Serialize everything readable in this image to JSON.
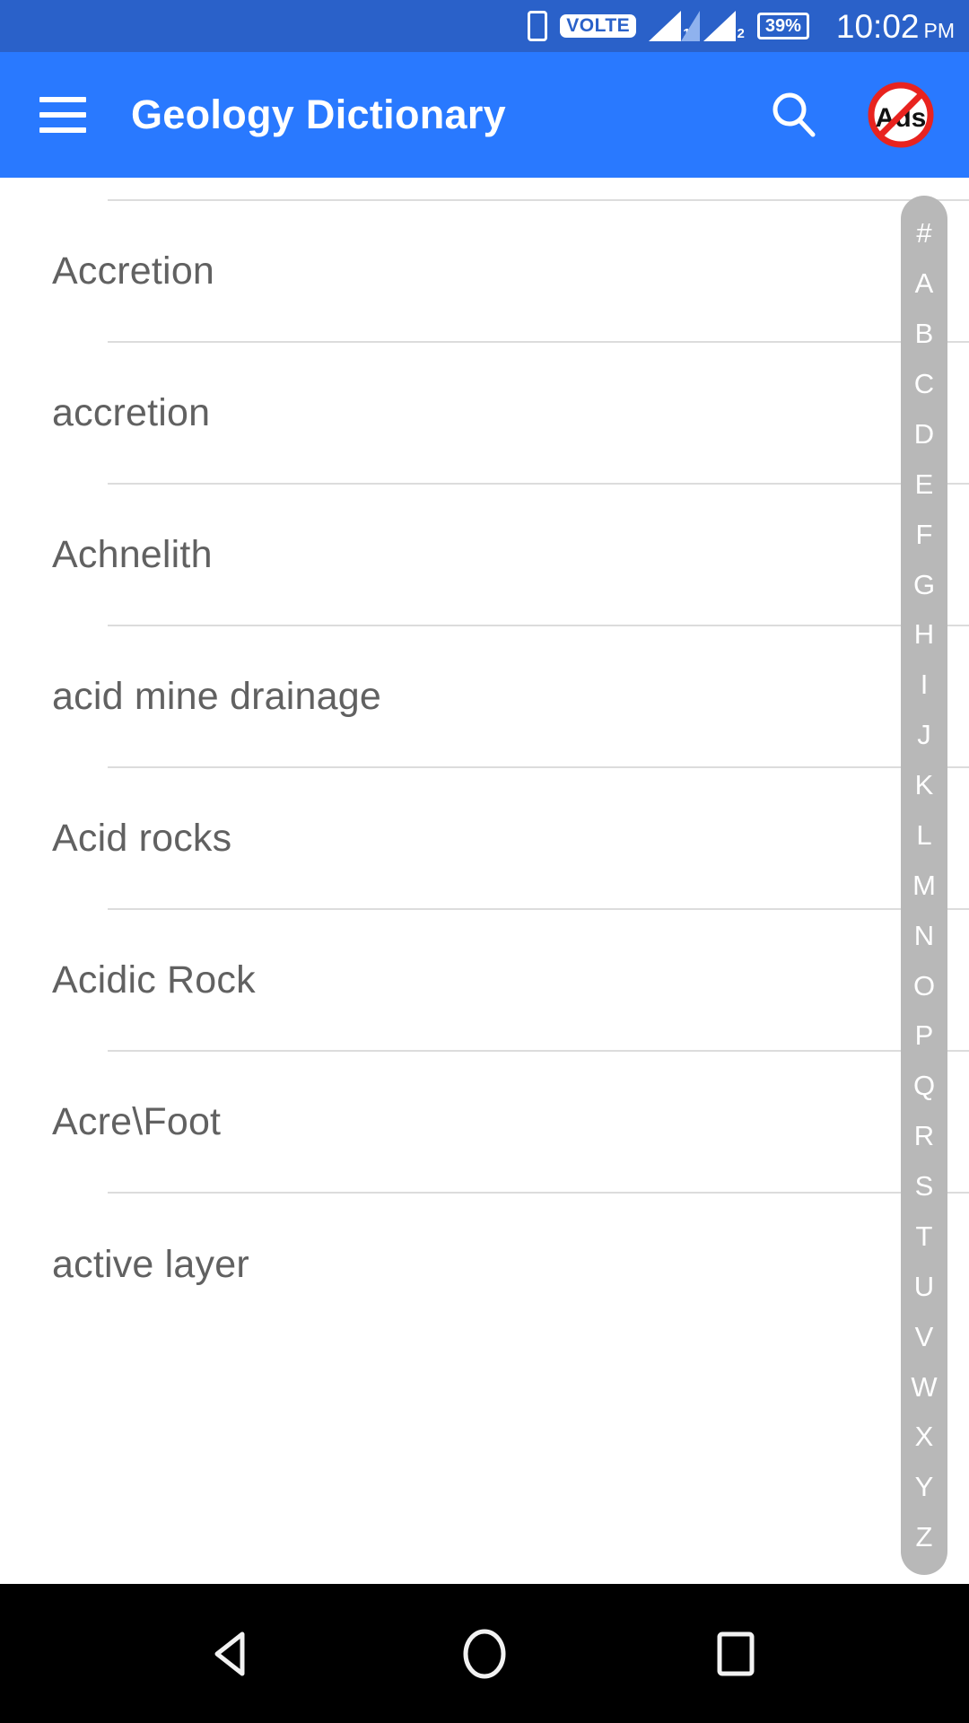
{
  "status_bar": {
    "background_color": "#2a61c9",
    "phone_icon": "phone-icon",
    "volte_label": "VOLTE",
    "sim1_label": "1",
    "sim2_label": "2",
    "battery_label": "39%",
    "time": "10:02",
    "am_pm": "PM"
  },
  "app_bar": {
    "background_color": "#2979ff",
    "menu_icon": "hamburger-menu-icon",
    "title": "Geology Dictionary",
    "search_icon": "search-icon",
    "ads_icon": "block-ads-icon",
    "ads_label": "Ads"
  },
  "list": {
    "items": [
      {
        "label": "Accretion"
      },
      {
        "label": "accretion"
      },
      {
        "label": "Achnelith"
      },
      {
        "label": "acid mine drainage"
      },
      {
        "label": "Acid rocks"
      },
      {
        "label": "Acidic Rock"
      },
      {
        "label": "Acre\\Foot"
      },
      {
        "label": "active layer"
      }
    ]
  },
  "fast_scroll": {
    "background_color": "#b8b8b8",
    "letters": [
      "#",
      "A",
      "B",
      "C",
      "D",
      "E",
      "F",
      "G",
      "H",
      "I",
      "J",
      "K",
      "L",
      "M",
      "N",
      "O",
      "P",
      "Q",
      "R",
      "S",
      "T",
      "U",
      "V",
      "W",
      "X",
      "Y",
      "Z"
    ]
  },
  "nav_bar": {
    "background_color": "#000000",
    "back_icon": "back-triangle-icon",
    "home_icon": "home-circle-icon",
    "recents_icon": "recents-square-icon"
  }
}
